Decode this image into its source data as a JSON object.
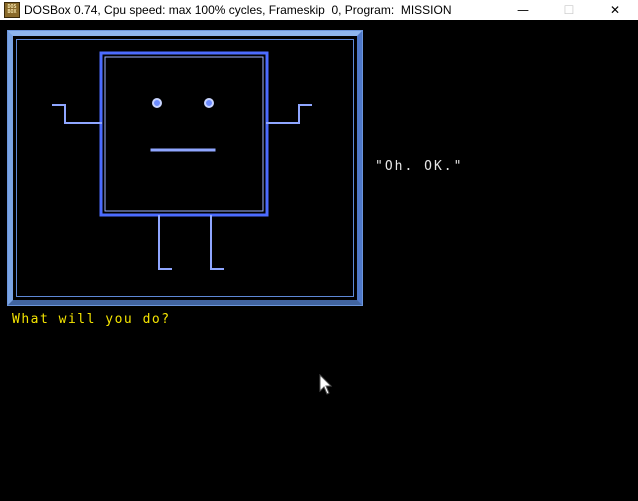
{
  "window": {
    "icon_text_top": "DOS",
    "icon_text_bottom": "BOX",
    "title": "DOSBox 0.74, Cpu speed: max 100% cycles, Frameskip  0, Program:  MISSION",
    "controls": {
      "minimize": "—",
      "maximize": "☐",
      "close": "✕"
    }
  },
  "game": {
    "dialogue": "\"Oh. OK.\"",
    "prompt": "What will you do?"
  },
  "colors": {
    "frame_light": "#8fb6ee",
    "frame_dark": "#41649f",
    "robot_line": "#6d8cff",
    "robot_line_bright": "#b8c8ff",
    "dialogue_text": "#e6e6e6",
    "prompt_text": "#f4e400"
  },
  "icons": {
    "app": "dosbox-icon",
    "cursor": "mouse-pointer-icon"
  }
}
